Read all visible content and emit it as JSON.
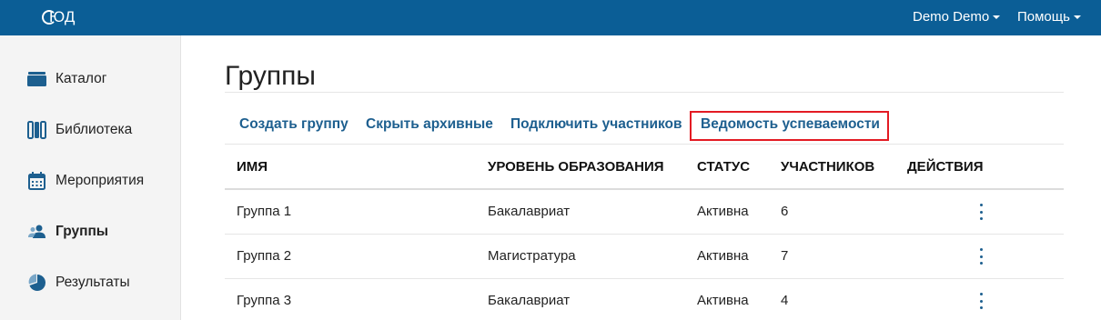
{
  "app": {
    "logo_text": "ЮД",
    "user_menu": "Demo Demo",
    "help_menu": "Помощь"
  },
  "sidebar": {
    "items": [
      {
        "label": "Каталог",
        "icon": "catalog-icon",
        "active": false
      },
      {
        "label": "Библиотека",
        "icon": "library-icon",
        "active": false
      },
      {
        "label": "Мероприятия",
        "icon": "calendar-icon",
        "active": false
      },
      {
        "label": "Группы",
        "icon": "users-icon",
        "active": true
      },
      {
        "label": "Результаты",
        "icon": "pie-chart-icon",
        "active": false
      }
    ]
  },
  "page": {
    "title": "Группы"
  },
  "toolbar": {
    "create_group": "Создать группу",
    "hide_archived": "Скрыть архивные",
    "connect_participants": "Подключить участников",
    "grade_report": "Ведомость успеваемости"
  },
  "table": {
    "headers": {
      "name": "ИМЯ",
      "level": "УРОВЕНЬ ОБРАЗОВАНИЯ",
      "status": "СТАТУС",
      "participants": "УЧАСТНИКОВ",
      "actions": "ДЕЙСТВИЯ"
    },
    "rows": [
      {
        "name": "Группа 1",
        "level": "Бакалавриат",
        "status": "Активна",
        "participants": "6"
      },
      {
        "name": "Группа 2",
        "level": "Магистратура",
        "status": "Активна",
        "participants": "7"
      },
      {
        "name": "Группа 3",
        "level": "Бакалавриат",
        "status": "Активна",
        "participants": "4"
      }
    ]
  },
  "colors": {
    "topbar": "#0b5e96",
    "link": "#1d5f8f",
    "highlight": "#e31b23",
    "sidebar_bg": "#f4f4f4"
  }
}
